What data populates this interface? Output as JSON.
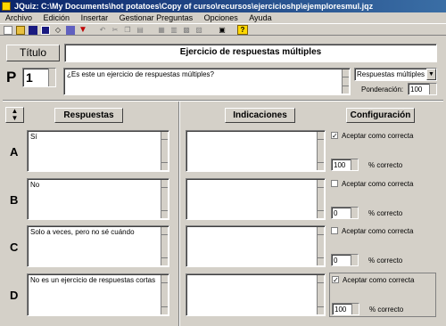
{
  "window": {
    "title": "JQuiz: C:\\My Documents\\hot potatoes\\Copy of curso\\recursos\\ejercicioshp\\ejemploresmul.jqz"
  },
  "menu": [
    "Archivo",
    "Edición",
    "Insertar",
    "Gestionar Preguntas",
    "Opciones",
    "Ayuda"
  ],
  "header": {
    "titulo_label": "Título",
    "title_value": "Ejercicio de respuestas múltiples"
  },
  "question": {
    "p_label": "P",
    "number": "1",
    "text": "¿Es este un ejercicio de respuestas múltiples?",
    "type": "Respuestas múltiples",
    "ponderacion_label": "Ponderación:",
    "ponderacion_value": "100"
  },
  "columns": {
    "respuestas": "Respuestas",
    "indicaciones": "Indicaciones",
    "configuracion": "Configuración"
  },
  "answers": [
    {
      "letter": "A",
      "text": "Sí",
      "feedback": "",
      "correct_label": "Aceptar como correcta",
      "correct": true,
      "percent": "100",
      "percent_label": "% correcto"
    },
    {
      "letter": "B",
      "text": "No",
      "feedback": "",
      "correct_label": "Aceptar como correcta",
      "correct": false,
      "percent": "0",
      "percent_label": "% correcto"
    },
    {
      "letter": "C",
      "text": "Solo a veces, pero no sé cuándo",
      "feedback": "",
      "correct_label": "Aceptar como correcta",
      "correct": false,
      "percent": "0",
      "percent_label": "% correcto"
    },
    {
      "letter": "D",
      "text": "No es un ejercicio de respuestas cortas",
      "feedback": "",
      "correct_label": "Aceptar como correcta",
      "correct": true,
      "percent": "100",
      "percent_label": "% correcto"
    }
  ],
  "colors": {
    "titlebar": "#0a246a",
    "face": "#d4d0c8"
  }
}
